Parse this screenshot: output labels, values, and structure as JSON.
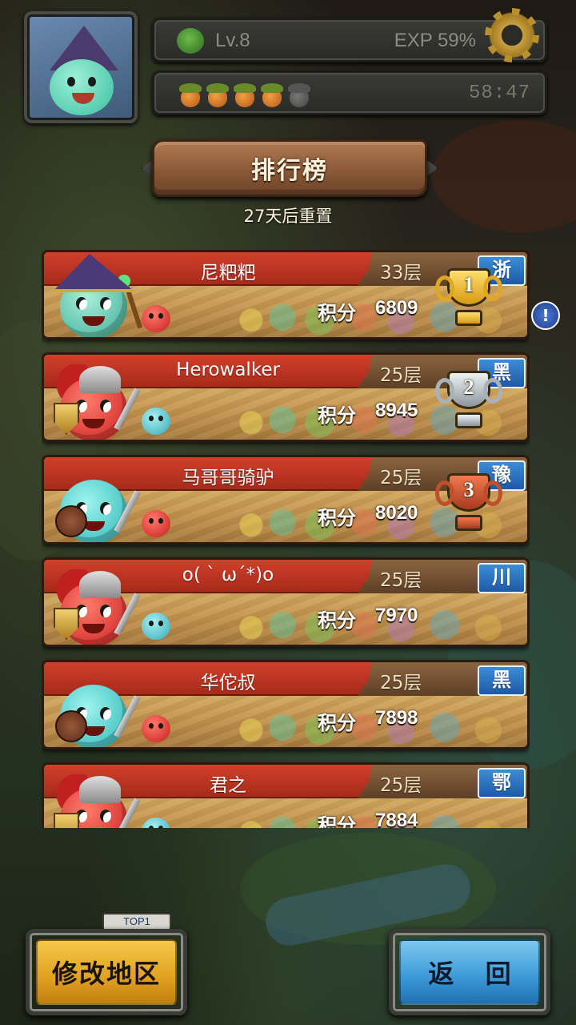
{
  "hud": {
    "level": "Lv.8",
    "exp": "EXP 59%",
    "energy_filled": 4,
    "energy_total": 5,
    "timer": "58:47"
  },
  "title": "排行榜",
  "reset_text": "27天后重置",
  "score_label": "积分",
  "rankings": [
    {
      "name": "尼粑粑",
      "floor": "33层",
      "score": "6809",
      "region": "浙",
      "trophy": "1",
      "character": "witch",
      "companion": "red"
    },
    {
      "name": "Herowalker",
      "floor": "25层",
      "score": "8945",
      "region": "黑",
      "trophy": "2",
      "character": "knight",
      "companion": "teal"
    },
    {
      "name": "马哥哥骑驴",
      "floor": "25层",
      "score": "8020",
      "region": "豫",
      "trophy": "3",
      "character": "blob",
      "companion": "red"
    },
    {
      "name": "o( ` ω´*)o",
      "floor": "25层",
      "score": "7970",
      "region": "川",
      "trophy": "",
      "character": "knight",
      "companion": "teal"
    },
    {
      "name": "华佗叔",
      "floor": "25层",
      "score": "7898",
      "region": "黑",
      "trophy": "",
      "character": "blob",
      "companion": "red"
    },
    {
      "name": "君之",
      "floor": "25层",
      "score": "7884",
      "region": "鄂",
      "trophy": "",
      "character": "knight",
      "companion": "teal"
    }
  ],
  "sign_text": "TOP1",
  "side_icon": "!",
  "buttons": {
    "change_region": "修改地区",
    "back": "返 回"
  },
  "icons": {
    "level": "clover-icon",
    "settings": "gear-icon",
    "energy": "acorn-icon"
  },
  "colors": {
    "row_header": "#c0321f",
    "region_badge": "#2a74c4",
    "button_region": "#e8aa26",
    "button_back": "#3a98d8"
  }
}
